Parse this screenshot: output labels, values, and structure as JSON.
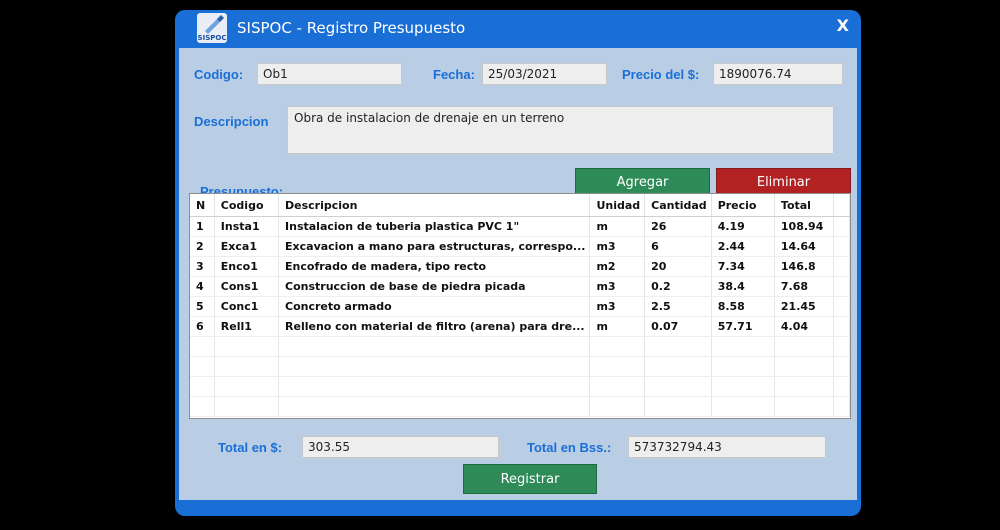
{
  "window": {
    "title": "SISPOC - Registro Presupuesto",
    "logo_text": "SISPOC",
    "close_label": "X"
  },
  "form": {
    "codigo_label": "Codigo:",
    "codigo_value": "Ob1",
    "fecha_label": "Fecha:",
    "fecha_value": "25/03/2021",
    "precio_label": "Precio del $:",
    "precio_value": "1890076.74",
    "descripcion_label": "Descripcion",
    "descripcion_value": "Obra de instalacion de drenaje en un terreno",
    "presupuesto_label": "Presupuesto:"
  },
  "buttons": {
    "agregar": "Agregar",
    "eliminar": "Eliminar",
    "registrar": "Registrar"
  },
  "colors": {
    "agregar": "#2e8b57",
    "eliminar": "#b22222",
    "registrar": "#2e8b57",
    "label": "#1a6fd6"
  },
  "table": {
    "headers": [
      "N",
      "Codigo",
      "Descripcion",
      "Unidad",
      "Cantidad",
      "Precio",
      "Total"
    ],
    "rows": [
      [
        "1",
        "Insta1",
        "Instalacion de tuberia plastica PVC 1\"",
        "m",
        "26",
        "4.19",
        "108.94"
      ],
      [
        "2",
        "Exca1",
        "Excavacion a mano para estructuras, correspo...",
        "m3",
        "6",
        "2.44",
        "14.64"
      ],
      [
        "3",
        "Enco1",
        "Encofrado de madera, tipo recto",
        "m2",
        "20",
        "7.34",
        "146.8"
      ],
      [
        "4",
        "Cons1",
        "Construccion de base de piedra picada",
        "m3",
        "0.2",
        "38.4",
        "7.68"
      ],
      [
        "5",
        "Conc1",
        "Concreto armado",
        "m3",
        "2.5",
        "8.58",
        "21.45"
      ],
      [
        "6",
        "Rell1",
        "Relleno con material de filtro (arena) para dre...",
        "m",
        "0.07",
        "57.71",
        "4.04"
      ]
    ]
  },
  "totals": {
    "usd_label": "Total en $:",
    "usd_value": "303.55",
    "bss_label": "Total en Bss.:",
    "bss_value": "573732794.43"
  }
}
